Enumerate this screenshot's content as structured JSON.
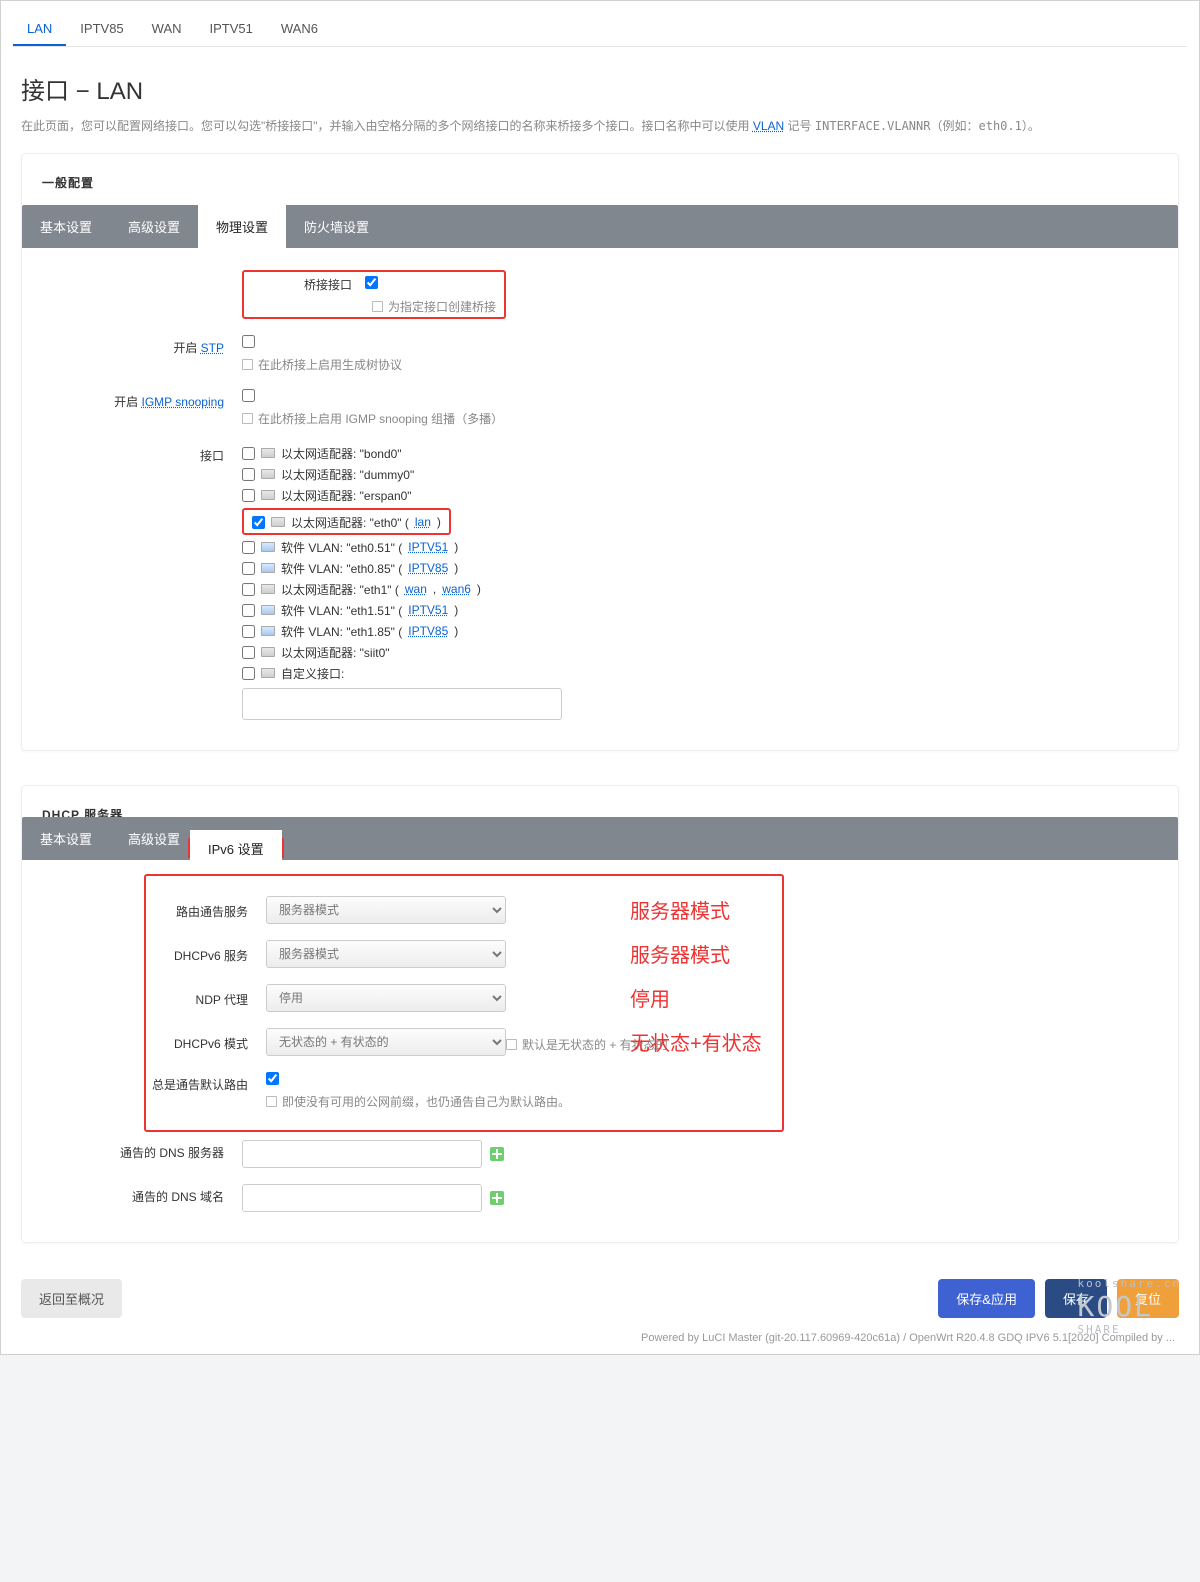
{
  "topTabs": [
    "LAN",
    "IPTV85",
    "WAN",
    "IPTV51",
    "WAN6"
  ],
  "topActive": 0,
  "pageTitle": "接口 − LAN",
  "desc": {
    "a": "在此页面，您可以配置网络接口。您可以勾选\"桥接接口\"，并输入由空格分隔的多个网络接口的名称来桥接多个接口。接口名称中可以使用 ",
    "vlanLink": "VLAN",
    "b": " 记号 ",
    "sample": "INTERFACE.VLANNR",
    "c": "（例如：",
    "sample2": "eth0.1",
    "d": "）。"
  },
  "general": {
    "title": "一般配置",
    "tabs": [
      "基本设置",
      "高级设置",
      "物理设置",
      "防火墙设置"
    ],
    "activeTab": 2,
    "bridge": {
      "label": "桥接接口",
      "checked": true,
      "hint": "为指定接口创建桥接"
    },
    "stp": {
      "label": "开启 ",
      "linkText": "STP",
      "checked": false,
      "hint": "在此桥接上启用生成树协议"
    },
    "igmp": {
      "label": "开启 ",
      "linkText": "IGMP snooping",
      "checked": false,
      "hint": "在此桥接上启用 IGMP snooping 组播（多播）"
    },
    "ifaceLabel": "接口",
    "customLabel": "自定义接口:",
    "ifaces": [
      {
        "checked": false,
        "vlan": false,
        "text": "以太网适配器: \"bond0\""
      },
      {
        "checked": false,
        "vlan": false,
        "text": "以太网适配器: \"dummy0\""
      },
      {
        "checked": false,
        "vlan": false,
        "text": "以太网适配器: \"erspan0\""
      },
      {
        "checked": true,
        "vlan": false,
        "text": "以太网适配器: \"eth0\" (",
        "links": [
          "lan"
        ],
        "tail": ")",
        "highlight": true
      },
      {
        "checked": false,
        "vlan": true,
        "text": "软件 VLAN: \"eth0.51\" (",
        "links": [
          "IPTV51"
        ],
        "tail": ")"
      },
      {
        "checked": false,
        "vlan": true,
        "text": "软件 VLAN: \"eth0.85\" (",
        "links": [
          "IPTV85"
        ],
        "tail": ")"
      },
      {
        "checked": false,
        "vlan": false,
        "text": "以太网适配器: \"eth1\" (",
        "links": [
          "wan",
          "wan6"
        ],
        "tail": ")"
      },
      {
        "checked": false,
        "vlan": true,
        "text": "软件 VLAN: \"eth1.51\" (",
        "links": [
          "IPTV51"
        ],
        "tail": ")"
      },
      {
        "checked": false,
        "vlan": true,
        "text": "软件 VLAN: \"eth1.85\" (",
        "links": [
          "IPTV85"
        ],
        "tail": ")"
      },
      {
        "checked": false,
        "vlan": false,
        "text": "以太网适配器: \"siit0\""
      }
    ]
  },
  "dhcp": {
    "title": "DHCP 服务器",
    "tabs": [
      "基本设置",
      "高级设置",
      "IPv6 设置"
    ],
    "activeTab": 2,
    "rows": {
      "ra": {
        "label": "路由通告服务",
        "value": "服务器模式",
        "annot": "服务器模式"
      },
      "d6s": {
        "label": "DHCPv6 服务",
        "value": "服务器模式",
        "annot": "服务器模式"
      },
      "ndp": {
        "label": "NDP 代理",
        "value": "停用",
        "annot": "停用"
      },
      "mode": {
        "label": "DHCPv6 模式",
        "value": "无状态的 + 有状态的",
        "annot": "无状态+有状态",
        "hint": "默认是无状态的 + 有状态的"
      },
      "defrt": {
        "label": "总是通告默认路由",
        "checked": true,
        "hint": "即使没有可用的公网前缀，也仍通告自己为默认路由。"
      },
      "dns": {
        "label": "通告的 DNS 服务器"
      },
      "dnsd": {
        "label": "通告的 DNS 域名"
      }
    }
  },
  "buttons": {
    "back": "返回至概况",
    "saveApply": "保存&应用",
    "save": "保存",
    "reset": "复位"
  },
  "footer": "Powered by LuCI Master (git-20.117.60969-420c61a) / OpenWrt R20.4.8 GDQ IPV6 5.1[2020] Compiled by ...",
  "watermark": {
    "top": "koolshare.cn",
    "big": "KOOL",
    "sub": "SHARE"
  }
}
